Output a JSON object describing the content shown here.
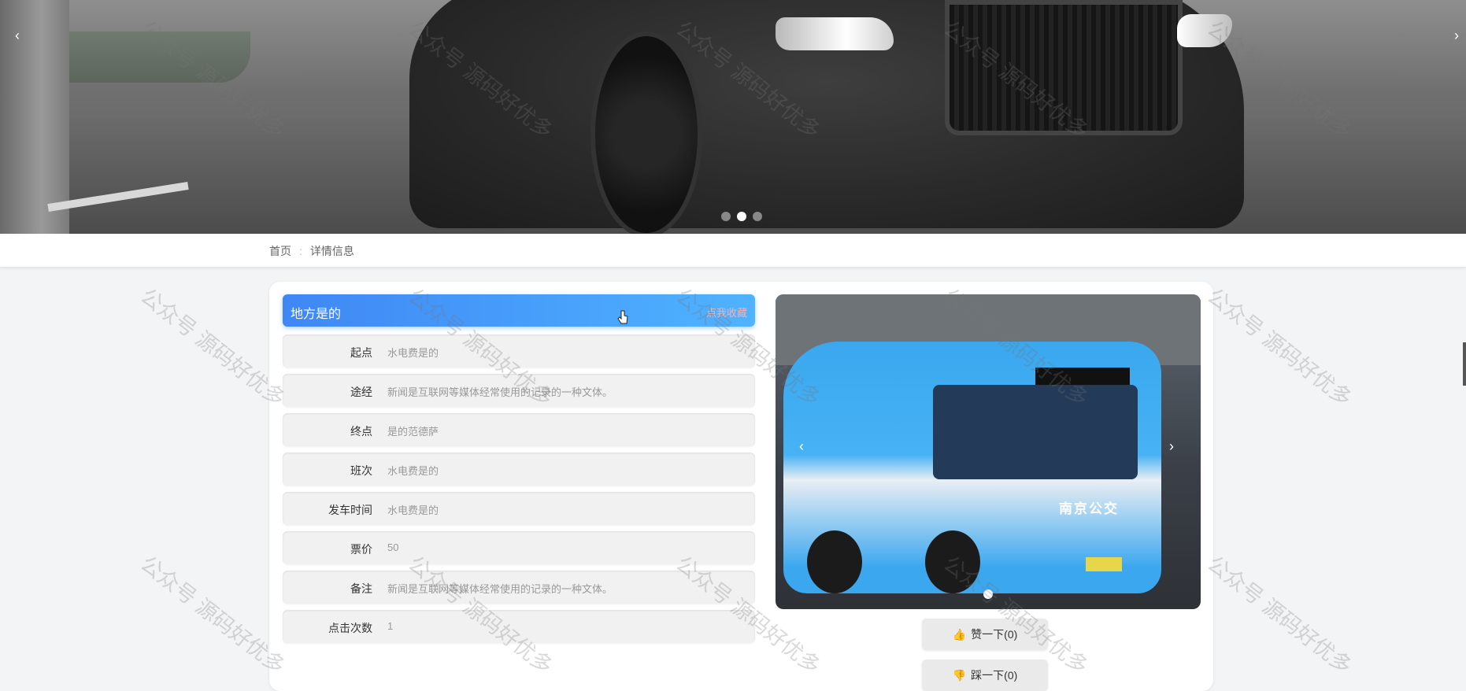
{
  "hero": {
    "prev_icon": "chevron-left-icon",
    "next_icon": "chevron-right-icon",
    "dots": [
      false,
      true,
      false
    ]
  },
  "watermark": "公众号 源码好优多",
  "breadcrumb": {
    "home": "首页",
    "current": "详情信息"
  },
  "detail": {
    "title": "地方是的",
    "favorite_label": "点我收藏",
    "fields": [
      {
        "label": "起点",
        "value": "水电费是的"
      },
      {
        "label": "途经",
        "value": "新闻是互联网等媒体经常使用的记录的一种文体。"
      },
      {
        "label": "终点",
        "value": "是的范德萨"
      },
      {
        "label": "班次",
        "value": "水电费是的"
      },
      {
        "label": "发车时间",
        "value": "水电费是的"
      },
      {
        "label": "票价",
        "value": "50"
      },
      {
        "label": "备注",
        "value": "新闻是互联网等媒体经常使用的记录的一种文体。"
      },
      {
        "label": "点击次数",
        "value": "1"
      }
    ]
  },
  "photo": {
    "brand_text": "南京公交"
  },
  "votes": {
    "up_label": "赞一下(0)",
    "down_label": "踩一下(0)"
  },
  "colors": {
    "accent_start": "#3f87f5",
    "accent_end": "#4fb3ff"
  }
}
